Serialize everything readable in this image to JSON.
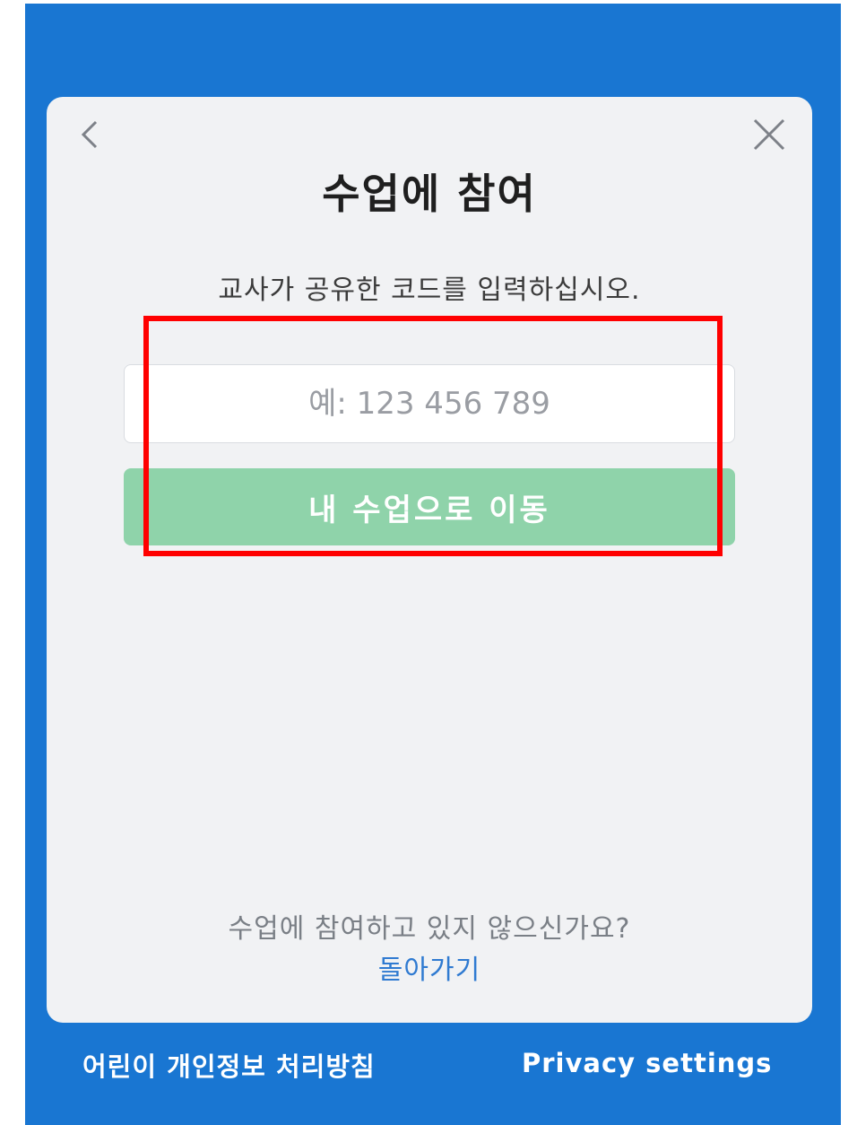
{
  "dialog": {
    "title": "수업에 참여",
    "subtitle": "교사가 공유한 코드를 입력하십시오.",
    "code_input": {
      "placeholder": "예: 123 456 789",
      "value": ""
    },
    "join_button_label": "내 수업으로 이동",
    "not_joining_text": "수업에 참여하고 있지 않으신가요?",
    "back_link_label": "돌아가기"
  },
  "footer": {
    "children_privacy_label": "어린이 개인정보 처리방침",
    "privacy_settings_label": "Privacy settings"
  },
  "icons": {
    "back": "chevron-left-icon",
    "close": "close-icon"
  },
  "colors": {
    "background": "#1976d2",
    "card": "#f1f2f4",
    "button": "#8fd3aa",
    "link": "#2f7ad1",
    "highlight": "#ff0000"
  }
}
